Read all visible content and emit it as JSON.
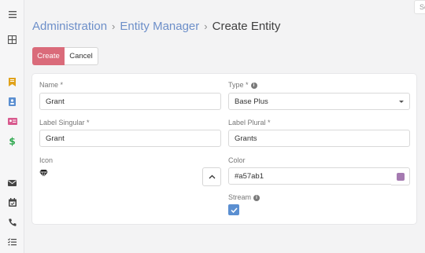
{
  "search": {
    "placeholder": "Se"
  },
  "sidebar": {
    "icons": [
      {
        "name": "menu-icon"
      },
      {
        "name": "dashboard-grid-icon"
      },
      {
        "name": "bookmark-icon"
      },
      {
        "name": "contact-card-icon"
      },
      {
        "name": "id-card-icon"
      },
      {
        "name": "dollar-icon"
      },
      {
        "name": "email-icon"
      },
      {
        "name": "calendar-icon"
      },
      {
        "name": "phone-icon"
      },
      {
        "name": "task-list-icon"
      }
    ]
  },
  "breadcrumb": {
    "items": [
      "Administration",
      "Entity Manager"
    ],
    "separator": "›",
    "current": "Create Entity"
  },
  "buttons": {
    "create": "Create",
    "cancel": "Cancel"
  },
  "form": {
    "name": {
      "label": "Name *",
      "value": "Grant"
    },
    "type": {
      "label": "Type *",
      "value": "Base Plus"
    },
    "label_singular": {
      "label": "Label Singular *",
      "value": "Grant"
    },
    "label_plural": {
      "label": "Label Plural *",
      "value": "Grants"
    },
    "icon": {
      "label": "Icon",
      "value": "diamond-icon"
    },
    "color": {
      "label": "Color",
      "value": "#a57ab1"
    },
    "stream": {
      "label": "Stream",
      "checked": true
    }
  },
  "colors": {
    "accent_link": "#6d8fc9",
    "create_button": "#da6b7a",
    "checkbox": "#5b8fd1",
    "sidebar_icons": [
      "#555555",
      "#555555",
      "#e0a21b",
      "#5b8fd1",
      "#d85a8e",
      "#2fa84f",
      "#444444",
      "#444444",
      "#444444",
      "#444444"
    ]
  }
}
